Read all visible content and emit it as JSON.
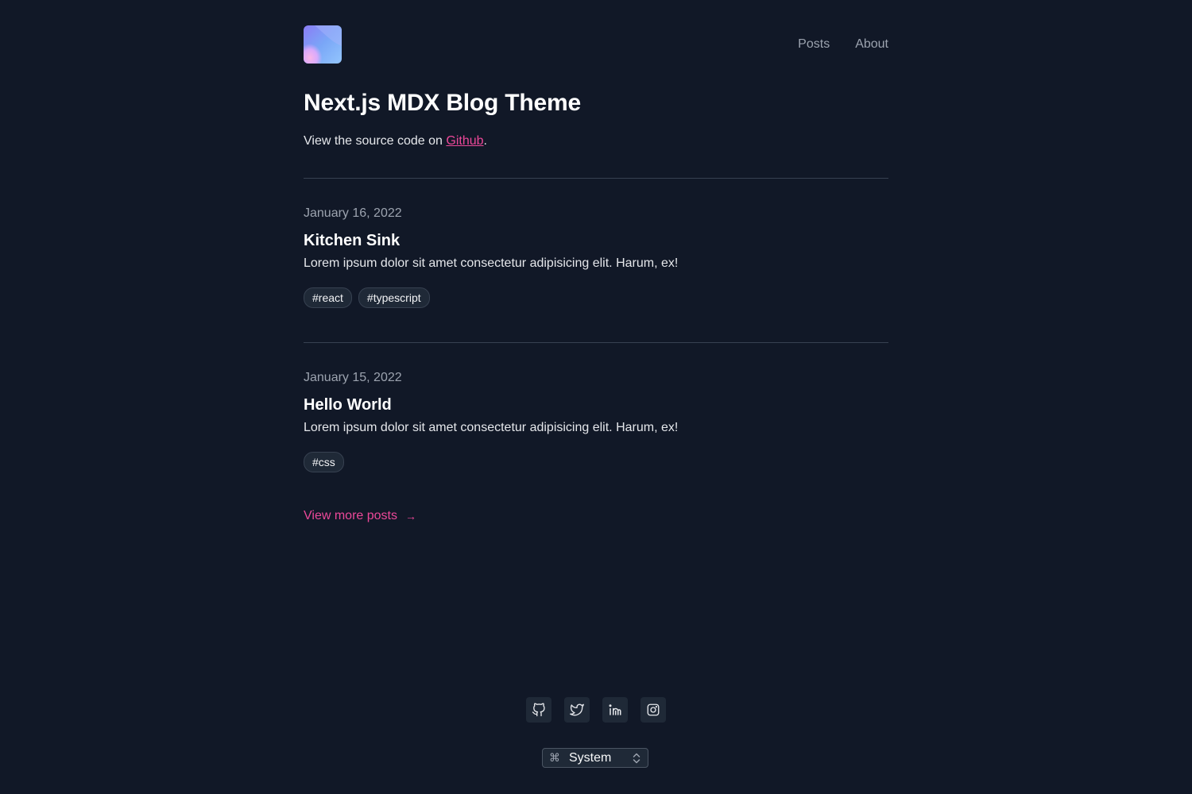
{
  "header": {
    "nav": [
      {
        "label": "Posts"
      },
      {
        "label": "About"
      }
    ]
  },
  "hero": {
    "title": "Next.js MDX Blog Theme",
    "subtitle_prefix": "View the source code on ",
    "subtitle_link": "Github",
    "subtitle_suffix": "."
  },
  "posts": [
    {
      "date": "January 16, 2022",
      "title": "Kitchen Sink",
      "excerpt": "Lorem ipsum dolor sit amet consectetur adipisicing elit. Harum, ex!",
      "tags": [
        "#react",
        "#typescript"
      ]
    },
    {
      "date": "January 15, 2022",
      "title": "Hello World",
      "excerpt": "Lorem ipsum dolor sit amet consectetur adipisicing elit. Harum, ex!",
      "tags": [
        "#css"
      ]
    }
  ],
  "more_link": {
    "label": "View more posts",
    "arrow": "→"
  },
  "footer": {
    "social_icons": [
      "github-icon",
      "twitter-icon",
      "linkedin-icon",
      "instagram-icon"
    ],
    "theme_select": {
      "shortcut": "⌘",
      "value": "System"
    }
  },
  "colors": {
    "background": "#111827",
    "accent": "#ec4899",
    "heading": "#ffffff",
    "muted": "#9ca3af"
  }
}
